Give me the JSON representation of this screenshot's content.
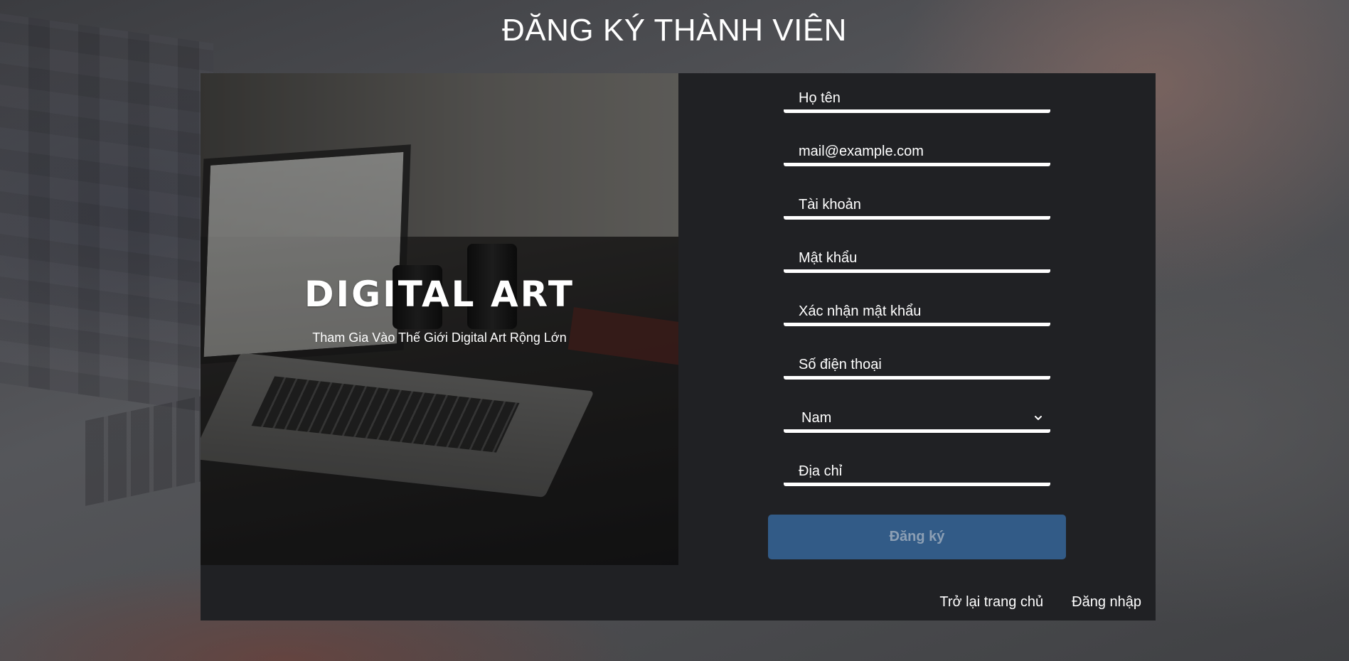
{
  "page": {
    "title": "ĐĂNG KÝ THÀNH VIÊN"
  },
  "hero": {
    "title": "DIGITAL ART",
    "subtitle": "Tham Gia Vào Thế Giới Digital Art Rộng Lớn"
  },
  "form": {
    "full_name": {
      "placeholder": "Họ tên",
      "value": ""
    },
    "email": {
      "placeholder": "mail@example.com",
      "value": ""
    },
    "username": {
      "placeholder": "Tài khoản",
      "value": ""
    },
    "password": {
      "placeholder": "Mật khẩu",
      "value": ""
    },
    "confirm_password": {
      "placeholder": "Xác nhận mật khẩu",
      "value": ""
    },
    "phone": {
      "placeholder": "Số điện thoại",
      "value": ""
    },
    "gender": {
      "selected": "Nam"
    },
    "address": {
      "placeholder": "Địa chỉ",
      "value": ""
    },
    "submit_label": "Đăng ký"
  },
  "footer": {
    "back_home": "Trở lại trang chủ",
    "login": "Đăng nhập"
  },
  "colors": {
    "card_bg": "#202124",
    "submit_bg": "#325b87",
    "field_underline": "#ffffff"
  },
  "icons": {
    "gender_dropdown": "chevron-down-icon"
  }
}
